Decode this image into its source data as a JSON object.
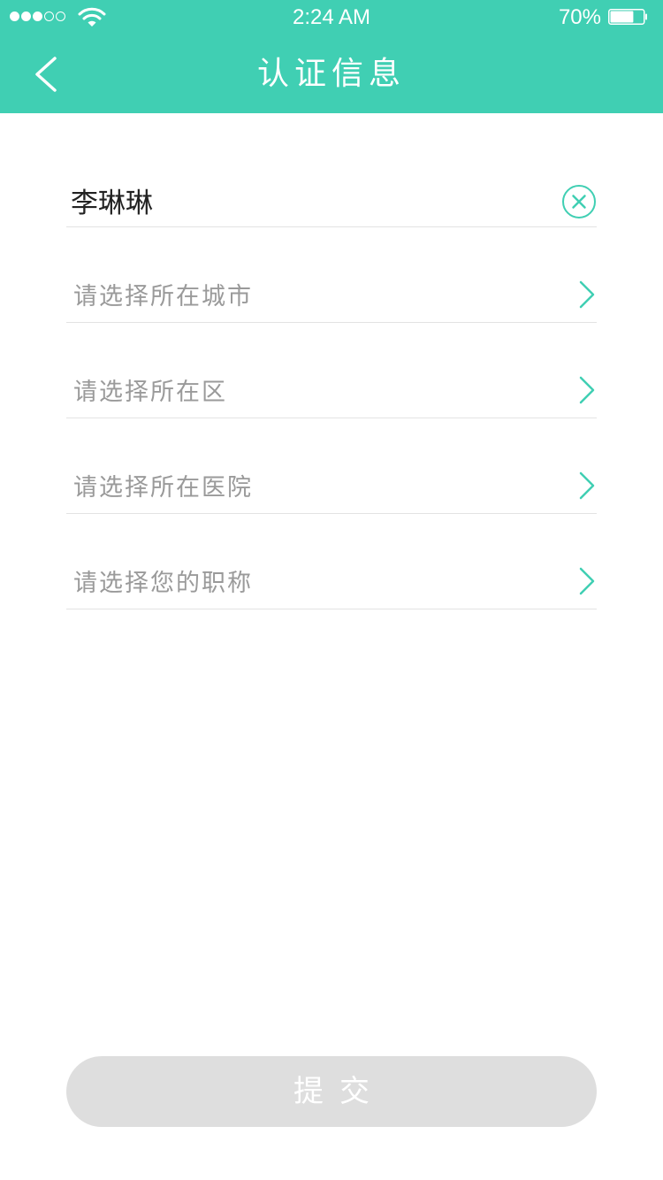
{
  "status_bar": {
    "time": "2:24 AM",
    "battery_percent": "70%",
    "battery_level": 0.7,
    "signal_strength": 3,
    "signal_max": 5,
    "signal_icon": "signal-dots-icon",
    "wifi_icon": "wifi-icon",
    "battery_icon": "battery-icon"
  },
  "header": {
    "title": "认证信息",
    "back_icon": "chevron-left-icon",
    "background_color": "#40cfb3"
  },
  "form": {
    "name_value": "李琳琳",
    "clear_icon": "clear-circle-icon",
    "select_icon": "chevron-right-icon",
    "fields": [
      {
        "label": "请选择所在城市"
      },
      {
        "label": "请选择所在区"
      },
      {
        "label": "请选择所在医院"
      },
      {
        "label": "请选择您的职称"
      }
    ],
    "submit_label": "提交",
    "submit_background": "#dedede"
  },
  "accent_color": "#40cfb3"
}
